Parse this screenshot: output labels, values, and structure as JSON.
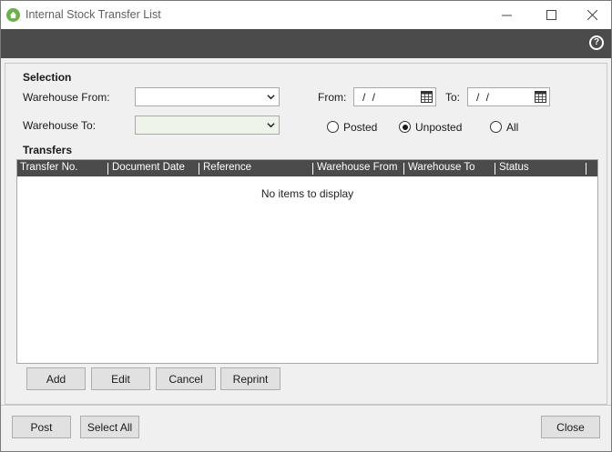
{
  "window": {
    "title": "Internal Stock Transfer List",
    "minimize_glyph": "—",
    "maximize_glyph": "☐",
    "close_glyph": "✕"
  },
  "toolbar": {
    "help_glyph": "?"
  },
  "selection": {
    "title": "Selection",
    "warehouse_from_label": "Warehouse From:",
    "warehouse_from_value": "",
    "warehouse_to_label": "Warehouse To:",
    "warehouse_to_value": "",
    "from_label": "From:",
    "from_value": "/ /",
    "to_label": "To:",
    "to_value": "/ /",
    "status_options": [
      {
        "label": "Posted",
        "checked": false
      },
      {
        "label": "Unposted",
        "checked": true
      },
      {
        "label": "All",
        "checked": false
      }
    ]
  },
  "transfers": {
    "title": "Transfers",
    "columns": [
      "Transfer No.",
      "Document Date",
      "Reference",
      "Warehouse From",
      "Warehouse To",
      "Status"
    ],
    "empty_text": "No items to display"
  },
  "grid_buttons": {
    "add": "Add",
    "edit": "Edit",
    "cancel": "Cancel",
    "reprint": "Reprint"
  },
  "footer_buttons": {
    "post": "Post",
    "select_all": "Select All",
    "close": "Close"
  },
  "colors": {
    "dark_band": "#4b4b4b",
    "app_icon": "#6ab04c",
    "warehouse_to_bg": "#eef4ea"
  }
}
